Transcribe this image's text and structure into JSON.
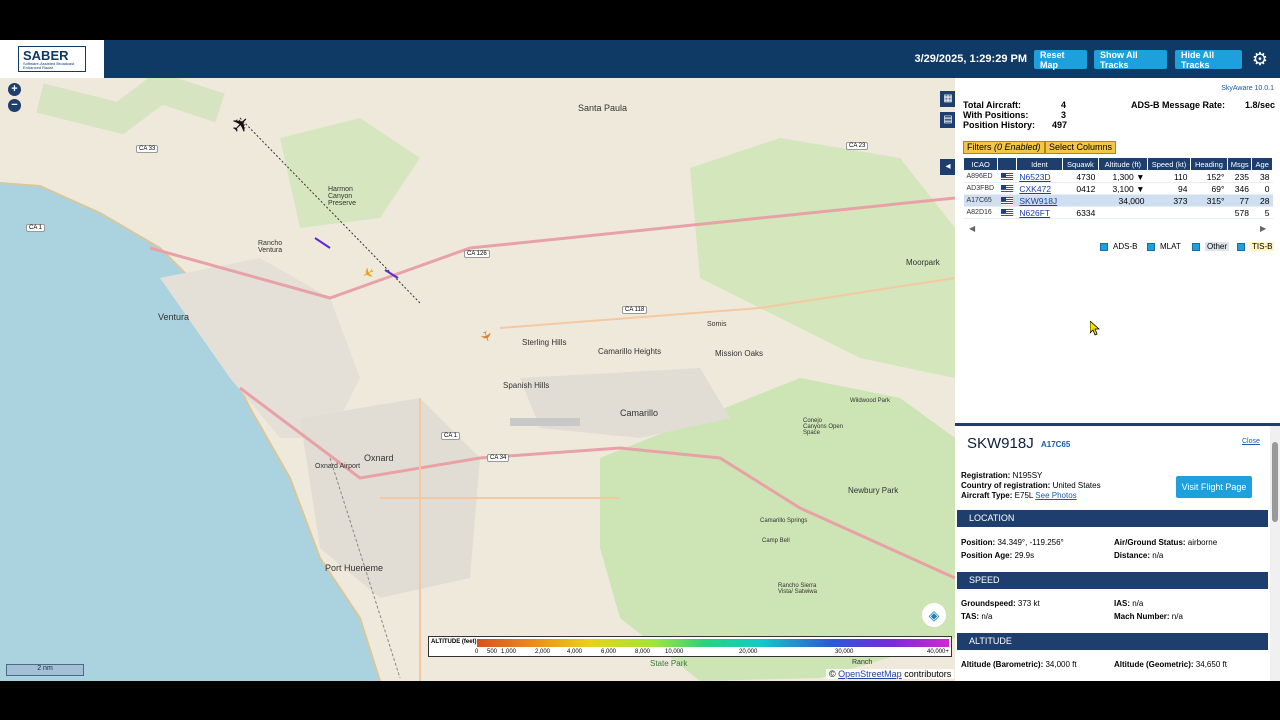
{
  "header": {
    "logo_title": "SABER",
    "logo_sub": "Software-Assisted Broadcast Enhanced Radar",
    "timestamp": "3/29/2025, 1:29:29 PM",
    "reset_map": "Reset Map",
    "show_all": "Show All Tracks",
    "hide_all": "Hide All Tracks",
    "settings_icon": "gear-icon"
  },
  "map": {
    "places": [
      "Santa Paula",
      "Harmon Canyon Preserve",
      "Rancho Ventura",
      "Ventura",
      "Sterling Hills",
      "Camarillo Heights",
      "Mission Oaks",
      "Somis",
      "Spanish Hills",
      "Camarillo",
      "Moorpark",
      "Oxnard",
      "Oxnard Airport",
      "Port Hueneme",
      "Wildwood Park",
      "Conejo Canyons Open Space",
      "Newbury Park",
      "Rancho Sierra Vista/ Satwiwa",
      "Camarillo Springs",
      "Camp Bell",
      "State Park",
      "Ranch"
    ],
    "routes": [
      "CA 33",
      "CA 23",
      "CA 1",
      "CA 126",
      "CA 118",
      "CA 1",
      "CA 34"
    ],
    "legend_title": "ALTITUDE (feet)",
    "legend_ticks": [
      "0",
      "500",
      "1,000",
      "2,000",
      "4,000",
      "6,000",
      "8,000",
      "10,000",
      "20,000",
      "30,000",
      "40,000+"
    ],
    "scale": "2 nm",
    "attribution_prefix": "©",
    "attribution_link": "OpenStreetMap",
    "attribution_suffix": "contributors"
  },
  "panel": {
    "version": "SkyAware 10.0.1",
    "total_aircraft_label": "Total Aircraft:",
    "total_aircraft": "4",
    "with_positions_label": "With Positions:",
    "with_positions": "3",
    "history_label": "Position History:",
    "history": "497",
    "rate_label": "ADS-B Message Rate:",
    "rate": "1.8/sec",
    "filters_btn": "Filters",
    "filters_enabled": "(0 Enabled)",
    "columns_btn": "Select Columns",
    "columns": [
      "ICAO",
      "",
      "Ident",
      "Squawk",
      "Altitude (ft)",
      "Speed (kt)",
      "Heading",
      "Msgs",
      "Age"
    ],
    "rows": [
      {
        "icao": "A896ED",
        "ident": "N6523D",
        "squawk": "4730",
        "alt": "1,300 ▼",
        "speed": "110",
        "heading": "152°",
        "msgs": "235",
        "age": "38"
      },
      {
        "icao": "AD3FBD",
        "ident": "CXK472",
        "squawk": "0412",
        "alt": "3,100 ▼",
        "speed": "94",
        "heading": "69°",
        "msgs": "346",
        "age": "0"
      },
      {
        "icao": "A17C65",
        "ident": "SKW918J",
        "squawk": "",
        "alt": "34,000",
        "speed": "373",
        "heading": "315°",
        "msgs": "77",
        "age": "28"
      },
      {
        "icao": "A82D16",
        "ident": "N626FT",
        "squawk": "6334",
        "alt": "",
        "speed": "",
        "heading": "",
        "msgs": "578",
        "age": "5"
      }
    ],
    "sources": [
      "ADS-B",
      "MLAT",
      "Other",
      "TIS-B"
    ]
  },
  "detail": {
    "callsign": "SKW918J",
    "icao": "A17C65",
    "close": "Close",
    "registration_label": "Registration:",
    "registration": "N195SY",
    "country_label": "Country of registration:",
    "country": "United States",
    "type_label": "Aircraft Type:",
    "type": "E75L",
    "see_photos": "See Photos",
    "visit_btn": "Visit Flight Page",
    "sec_location": "LOCATION",
    "sec_speed": "SPEED",
    "sec_altitude": "ALTITUDE",
    "position_label": "Position:",
    "position": "34.349°, -119.256°",
    "airground_label": "Air/Ground Status:",
    "airground": "airborne",
    "posage_label": "Position Age:",
    "posage": "29.9s",
    "distance_label": "Distance:",
    "distance": "n/a",
    "gs_label": "Groundspeed:",
    "gs": "373 kt",
    "ias_label": "IAS:",
    "ias": "n/a",
    "tas_label": "TAS:",
    "tas": "n/a",
    "mach_label": "Mach Number:",
    "mach": "n/a",
    "altbaro_label": "Altitude (Barometric):",
    "altbaro": "34,000 ft",
    "altgeo_label": "Altitude (Geometric):",
    "altgeo": "34,650 ft"
  }
}
